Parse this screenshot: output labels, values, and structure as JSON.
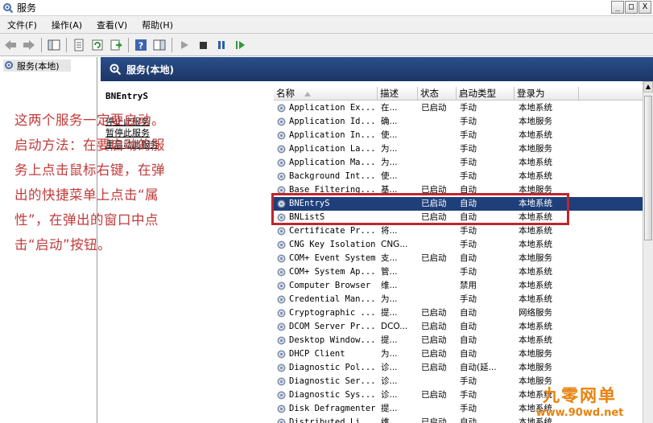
{
  "window": {
    "title": "服务",
    "min": "_",
    "max": "□",
    "close": "X"
  },
  "menu": [
    "文件(F)",
    "操作(A)",
    "查看(V)",
    "帮助(H)"
  ],
  "tree": {
    "root": "服务(本地)"
  },
  "header": {
    "title": "服务(本地)"
  },
  "details": {
    "service_name": "BNEntryS",
    "links": [
      "停止此服务",
      "暂停此服务",
      "重启动此服务"
    ]
  },
  "note": "这两个服务一定要启动。启动方法：在要启动的服务上点击鼠标右键，在弹出的快捷菜单上点击“属性”，在弹出的窗口中点击“启动”按钮。",
  "columns": [
    "名称",
    "描述",
    "状态",
    "启动类型",
    "登录为"
  ],
  "rows": [
    {
      "name": "Application Ex...",
      "desc": "在...",
      "status": "已启动",
      "start": "手动",
      "logon": "本地系统"
    },
    {
      "name": "Application Id...",
      "desc": "确...",
      "status": "",
      "start": "手动",
      "logon": "本地服务"
    },
    {
      "name": "Application In...",
      "desc": "使...",
      "status": "",
      "start": "手动",
      "logon": "本地系统"
    },
    {
      "name": "Application La...",
      "desc": "为...",
      "status": "",
      "start": "手动",
      "logon": "本地服务"
    },
    {
      "name": "Application Ma...",
      "desc": "为...",
      "status": "",
      "start": "手动",
      "logon": "本地系统"
    },
    {
      "name": "Background Int...",
      "desc": "使...",
      "status": "",
      "start": "手动",
      "logon": "本地系统"
    },
    {
      "name": "Base Filtering...",
      "desc": "基...",
      "status": "已启动",
      "start": "自动",
      "logon": "本地服务"
    },
    {
      "name": "BNEntryS",
      "desc": "",
      "status": "已启动",
      "start": "自动",
      "logon": "本地系统"
    },
    {
      "name": "BNListS",
      "desc": "",
      "status": "已启动",
      "start": "自动",
      "logon": "本地系统"
    },
    {
      "name": "Certificate Pr...",
      "desc": "将...",
      "status": "",
      "start": "手动",
      "logon": "本地系统"
    },
    {
      "name": "CNG Key Isolation",
      "desc": "CNG...",
      "status": "",
      "start": "手动",
      "logon": "本地系统"
    },
    {
      "name": "COM+ Event System",
      "desc": "支...",
      "status": "已启动",
      "start": "自动",
      "logon": "本地服务"
    },
    {
      "name": "COM+ System Ap...",
      "desc": "管...",
      "status": "",
      "start": "手动",
      "logon": "本地系统"
    },
    {
      "name": "Computer Browser",
      "desc": "维...",
      "status": "",
      "start": "禁用",
      "logon": "本地系统"
    },
    {
      "name": "Credential Man...",
      "desc": "为...",
      "status": "",
      "start": "手动",
      "logon": "本地系统"
    },
    {
      "name": "Cryptographic ...",
      "desc": "提...",
      "status": "已启动",
      "start": "自动",
      "logon": "网络服务"
    },
    {
      "name": "DCOM Server Pr...",
      "desc": "DCO...",
      "status": "已启动",
      "start": "自动",
      "logon": "本地系统"
    },
    {
      "name": "Desktop Window...",
      "desc": "提...",
      "status": "已启动",
      "start": "自动",
      "logon": "本地系统"
    },
    {
      "name": "DHCP Client",
      "desc": "为...",
      "status": "已启动",
      "start": "自动",
      "logon": "本地服务"
    },
    {
      "name": "Diagnostic Pol...",
      "desc": "诊...",
      "status": "已启动",
      "start": "自动(延...",
      "logon": "本地服务"
    },
    {
      "name": "Diagnostic Ser...",
      "desc": "诊...",
      "status": "",
      "start": "手动",
      "logon": "本地服务"
    },
    {
      "name": "Diagnostic Sys...",
      "desc": "诊...",
      "status": "已启动",
      "start": "手动",
      "logon": "本地系统"
    },
    {
      "name": "Disk Defragmenter",
      "desc": "提...",
      "status": "",
      "start": "手动",
      "logon": "本地系统"
    },
    {
      "name": "Distributed Li...",
      "desc": "维...",
      "status": "已启动",
      "start": "自动",
      "logon": "本地系统"
    }
  ],
  "selected_row": 7,
  "watermark": {
    "line1": "九零网单",
    "line2": "www.90wd.net"
  }
}
